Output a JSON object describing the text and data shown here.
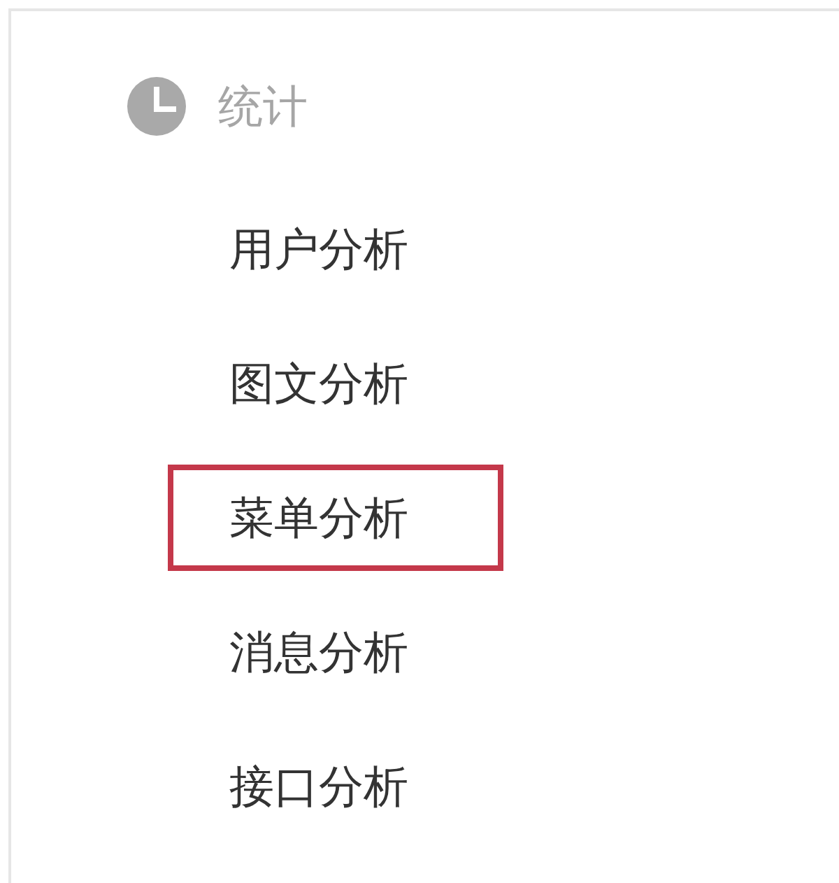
{
  "section": {
    "title": "统计"
  },
  "items": [
    {
      "label": "用户分析",
      "highlighted": false
    },
    {
      "label": "图文分析",
      "highlighted": false
    },
    {
      "label": "菜单分析",
      "highlighted": true
    },
    {
      "label": "消息分析",
      "highlighted": false
    },
    {
      "label": "接口分析",
      "highlighted": false
    }
  ]
}
